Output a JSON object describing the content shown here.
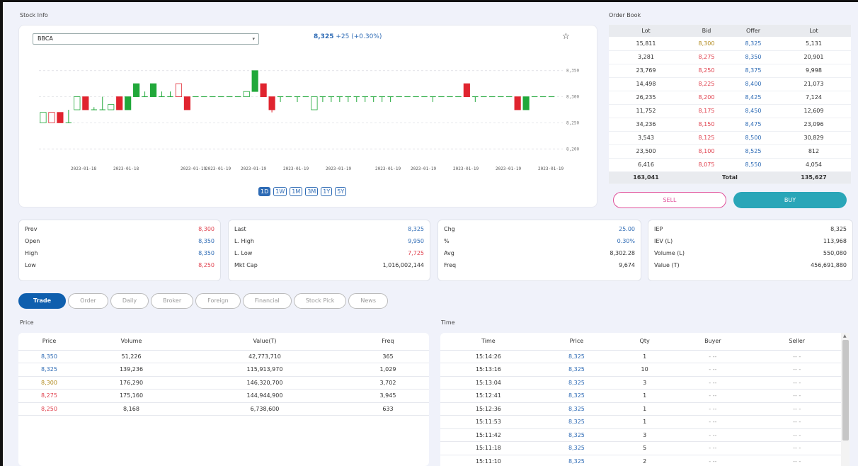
{
  "stock_info": {
    "section_title": "Stock Info",
    "symbol": "BBCA",
    "last": "8,325",
    "change": "+25 (+0.30%)",
    "y_ticks": [
      "8,350",
      "8,300",
      "8,250",
      "8,200"
    ],
    "x_ticks": [
      "2023-01-18",
      "2023-01-18",
      "2023-01-19",
      "2023-01-19",
      "2023-01-19",
      "2023-01-19",
      "2023-01-19",
      "2023-01-19",
      "2023-01-19",
      "2023-01-19",
      "2023-01-19",
      "2023-01-19"
    ],
    "ranges": [
      "1D",
      "1W",
      "1M",
      "3M",
      "1Y",
      "5Y"
    ],
    "active_range": "1D",
    "colors": {
      "up": "#21a83a",
      "down": "#e0242f",
      "flat": "#21a83a"
    }
  },
  "order_book": {
    "section_title": "Order Book",
    "headers": [
      "Lot",
      "Bid",
      "Offer",
      "Lot"
    ],
    "rows": [
      {
        "bid_lot": "15,811",
        "bid": "8,300",
        "bid_color": "olive",
        "offer": "8,325",
        "offer_lot": "5,131"
      },
      {
        "bid_lot": "3,281",
        "bid": "8,275",
        "bid_color": "red",
        "offer": "8,350",
        "offer_lot": "20,901"
      },
      {
        "bid_lot": "23,769",
        "bid": "8,250",
        "bid_color": "red",
        "offer": "8,375",
        "offer_lot": "9,998"
      },
      {
        "bid_lot": "14,498",
        "bid": "8,225",
        "bid_color": "red",
        "offer": "8,400",
        "offer_lot": "21,073"
      },
      {
        "bid_lot": "26,235",
        "bid": "8,200",
        "bid_color": "red",
        "offer": "8,425",
        "offer_lot": "7,124"
      },
      {
        "bid_lot": "11,752",
        "bid": "8,175",
        "bid_color": "red",
        "offer": "8,450",
        "offer_lot": "12,609"
      },
      {
        "bid_lot": "34,236",
        "bid": "8,150",
        "bid_color": "red",
        "offer": "8,475",
        "offer_lot": "23,096"
      },
      {
        "bid_lot": "3,543",
        "bid": "8,125",
        "bid_color": "red",
        "offer": "8,500",
        "offer_lot": "30,829"
      },
      {
        "bid_lot": "23,500",
        "bid": "8,100",
        "bid_color": "red",
        "offer": "8,525",
        "offer_lot": "812"
      },
      {
        "bid_lot": "6,416",
        "bid": "8,075",
        "bid_color": "red",
        "offer": "8,550",
        "offer_lot": "4,054"
      }
    ],
    "total_bid_lot": "163,041",
    "total_label": "Total",
    "total_offer_lot": "135,627",
    "sell_label": "SELL",
    "buy_label": "BUY"
  },
  "stats": [
    [
      {
        "k": "Prev",
        "v": "8,300",
        "c": "red"
      },
      {
        "k": "Open",
        "v": "8,350",
        "c": "blue"
      },
      {
        "k": "High",
        "v": "8,350",
        "c": "blue"
      },
      {
        "k": "Low",
        "v": "8,250",
        "c": "red"
      }
    ],
    [
      {
        "k": "Last",
        "v": "8,325",
        "c": "blue"
      },
      {
        "k": "L. High",
        "v": "9,950",
        "c": "blue"
      },
      {
        "k": "L. Low",
        "v": "7,725",
        "c": "red"
      },
      {
        "k": "Mkt Cap",
        "v": "1,016,002,144",
        "c": ""
      }
    ],
    [
      {
        "k": "Chg",
        "v": "25.00",
        "c": "blue"
      },
      {
        "k": "%",
        "v": "0.30%",
        "c": "blue"
      },
      {
        "k": "Avg",
        "v": "8,302.28",
        "c": ""
      },
      {
        "k": "Freq",
        "v": "9,674",
        "c": ""
      }
    ],
    [
      {
        "k": "IEP",
        "v": "8,325",
        "c": ""
      },
      {
        "k": "IEV (L)",
        "v": "113,968",
        "c": ""
      },
      {
        "k": "Volume (L)",
        "v": "550,080",
        "c": ""
      },
      {
        "k": "Value (T)",
        "v": "456,691,880",
        "c": ""
      }
    ]
  ],
  "tabs": [
    "Trade",
    "Order",
    "Daily",
    "Broker",
    "Foreign",
    "Financial",
    "Stock Pick",
    "News"
  ],
  "active_tab": "Trade",
  "price_table": {
    "section_title": "Price",
    "headers": [
      "Price",
      "Volume",
      "Value(T)",
      "Freq"
    ],
    "rows": [
      {
        "price": "8,350",
        "c": "blue",
        "volume": "51,226",
        "value": "42,773,710",
        "freq": "365"
      },
      {
        "price": "8,325",
        "c": "blue",
        "volume": "139,236",
        "value": "115,913,970",
        "freq": "1,029"
      },
      {
        "price": "8,300",
        "c": "olive",
        "volume": "176,290",
        "value": "146,320,700",
        "freq": "3,702"
      },
      {
        "price": "8,275",
        "c": "red",
        "volume": "175,160",
        "value": "144,944,900",
        "freq": "3,945"
      },
      {
        "price": "8,250",
        "c": "red",
        "volume": "8,168",
        "value": "6,738,600",
        "freq": "633"
      }
    ]
  },
  "time_table": {
    "section_title": "Time",
    "headers": [
      "Time",
      "Price",
      "Qty",
      "Buyer",
      "Seller"
    ],
    "rows": [
      {
        "time": "15:14:26",
        "price": "8,325",
        "qty": "1",
        "buyer": "- --",
        "seller": "-- -"
      },
      {
        "time": "15:13:16",
        "price": "8,325",
        "qty": "10",
        "buyer": "- --",
        "seller": "-- -"
      },
      {
        "time": "15:13:04",
        "price": "8,325",
        "qty": "3",
        "buyer": "- --",
        "seller": "-- -"
      },
      {
        "time": "15:12:41",
        "price": "8,325",
        "qty": "1",
        "buyer": "- --",
        "seller": "-- -"
      },
      {
        "time": "15:12:36",
        "price": "8,325",
        "qty": "1",
        "buyer": "- --",
        "seller": "-- -"
      },
      {
        "time": "15:11:53",
        "price": "8,325",
        "qty": "1",
        "buyer": "- --",
        "seller": "-- -"
      },
      {
        "time": "15:11:42",
        "price": "8,325",
        "qty": "3",
        "buyer": "- --",
        "seller": "-- -"
      },
      {
        "time": "15:11:18",
        "price": "8,325",
        "qty": "5",
        "buyer": "- --",
        "seller": "-- -"
      },
      {
        "time": "15:11:10",
        "price": "8,325",
        "qty": "2",
        "buyer": "- --",
        "seller": "-- -"
      }
    ]
  },
  "chart_data": {
    "type": "candlestick",
    "x": [
      "2023-01-18",
      "2023-01-18",
      "2023-01-19",
      "2023-01-19",
      "2023-01-19",
      "2023-01-19",
      "2023-01-19",
      "2023-01-19",
      "2023-01-19",
      "2023-01-19",
      "2023-01-19",
      "2023-01-19"
    ],
    "ylim": [
      8180,
      8370
    ],
    "y_ticks": [
      8350,
      8300,
      8250,
      8200
    ],
    "grid": true,
    "candles": [
      {
        "o": 8250,
        "c": 8270,
        "h": 8270,
        "l": 8250
      },
      {
        "o": 8270,
        "c": 8250,
        "h": 8270,
        "l": 8250
      },
      {
        "o": 8270,
        "c": 8250,
        "h": 8270,
        "l": 8250
      },
      {
        "o": 8250,
        "c": 8250,
        "h": 8275,
        "l": 8250
      },
      {
        "o": 8275,
        "c": 8300,
        "h": 8300,
        "l": 8275
      },
      {
        "o": 8300,
        "c": 8275,
        "h": 8300,
        "l": 8275
      },
      {
        "o": 8275,
        "c": 8275,
        "h": 8280,
        "l": 8275
      },
      {
        "o": 8275,
        "c": 8275,
        "h": 8300,
        "l": 8275
      },
      {
        "o": 8275,
        "c": 8285,
        "h": 8285,
        "l": 8275
      },
      {
        "o": 8300,
        "c": 8275,
        "h": 8300,
        "l": 8275
      },
      {
        "o": 8275,
        "c": 8300,
        "h": 8300,
        "l": 8275
      },
      {
        "o": 8300,
        "c": 8325,
        "h": 8325,
        "l": 8300
      },
      {
        "o": 8300,
        "c": 8300,
        "h": 8310,
        "l": 8300
      },
      {
        "o": 8300,
        "c": 8325,
        "h": 8325,
        "l": 8300
      },
      {
        "o": 8300,
        "c": 8300,
        "h": 8310,
        "l": 8300
      },
      {
        "o": 8300,
        "c": 8300,
        "h": 8310,
        "l": 8300
      },
      {
        "o": 8325,
        "c": 8300,
        "h": 8325,
        "l": 8300
      },
      {
        "o": 8300,
        "c": 8275,
        "h": 8300,
        "l": 8275
      },
      {
        "o": 8300,
        "c": 8300,
        "h": 8300,
        "l": 8300
      },
      {
        "o": 8300,
        "c": 8300,
        "h": 8300,
        "l": 8300
      },
      {
        "o": 8300,
        "c": 8300,
        "h": 8300,
        "l": 8300
      },
      {
        "o": 8300,
        "c": 8300,
        "h": 8300,
        "l": 8300
      },
      {
        "o": 8300,
        "c": 8300,
        "h": 8300,
        "l": 8300
      },
      {
        "o": 8300,
        "c": 8300,
        "h": 8300,
        "l": 8300
      },
      {
        "o": 8300,
        "c": 8310,
        "h": 8310,
        "l": 8300
      },
      {
        "o": 8310,
        "c": 8350,
        "h": 8350,
        "l": 8310
      },
      {
        "o": 8325,
        "c": 8300,
        "h": 8325,
        "l": 8300
      },
      {
        "o": 8300,
        "c": 8275,
        "h": 8300,
        "l": 8270
      },
      {
        "o": 8300,
        "c": 8300,
        "h": 8300,
        "l": 8290
      },
      {
        "o": 8300,
        "c": 8300,
        "h": 8300,
        "l": 8300
      },
      {
        "o": 8300,
        "c": 8300,
        "h": 8300,
        "l": 8290
      },
      {
        "o": 8300,
        "c": 8300,
        "h": 8300,
        "l": 8300
      },
      {
        "o": 8275,
        "c": 8300,
        "h": 8300,
        "l": 8275
      },
      {
        "o": 8300,
        "c": 8300,
        "h": 8300,
        "l": 8290
      },
      {
        "o": 8300,
        "c": 8300,
        "h": 8300,
        "l": 8290
      },
      {
        "o": 8300,
        "c": 8300,
        "h": 8300,
        "l": 8290
      },
      {
        "o": 8300,
        "c": 8300,
        "h": 8300,
        "l": 8290
      },
      {
        "o": 8300,
        "c": 8300,
        "h": 8300,
        "l": 8290
      },
      {
        "o": 8300,
        "c": 8300,
        "h": 8300,
        "l": 8290
      },
      {
        "o": 8300,
        "c": 8300,
        "h": 8300,
        "l": 8290
      },
      {
        "o": 8300,
        "c": 8300,
        "h": 8300,
        "l": 8290
      },
      {
        "o": 8300,
        "c": 8300,
        "h": 8300,
        "l": 8290
      },
      {
        "o": 8300,
        "c": 8300,
        "h": 8300,
        "l": 8300
      },
      {
        "o": 8300,
        "c": 8300,
        "h": 8300,
        "l": 8300
      },
      {
        "o": 8300,
        "c": 8300,
        "h": 8300,
        "l": 8300
      },
      {
        "o": 8300,
        "c": 8300,
        "h": 8300,
        "l": 8300
      },
      {
        "o": 8300,
        "c": 8300,
        "h": 8300,
        "l": 8290
      },
      {
        "o": 8300,
        "c": 8300,
        "h": 8300,
        "l": 8300
      },
      {
        "o": 8300,
        "c": 8300,
        "h": 8300,
        "l": 8300
      },
      {
        "o": 8300,
        "c": 8300,
        "h": 8300,
        "l": 8300
      },
      {
        "o": 8325,
        "c": 8300,
        "h": 8325,
        "l": 8300
      },
      {
        "o": 8300,
        "c": 8300,
        "h": 8300,
        "l": 8290
      },
      {
        "o": 8300,
        "c": 8300,
        "h": 8300,
        "l": 8300
      },
      {
        "o": 8300,
        "c": 8300,
        "h": 8300,
        "l": 8300
      },
      {
        "o": 8300,
        "c": 8300,
        "h": 8300,
        "l": 8300
      },
      {
        "o": 8300,
        "c": 8300,
        "h": 8300,
        "l": 8300
      },
      {
        "o": 8300,
        "c": 8275,
        "h": 8300,
        "l": 8275
      },
      {
        "o": 8275,
        "c": 8300,
        "h": 8300,
        "l": 8275
      },
      {
        "o": 8300,
        "c": 8300,
        "h": 8300,
        "l": 8300
      },
      {
        "o": 8300,
        "c": 8300,
        "h": 8300,
        "l": 8300
      },
      {
        "o": 8300,
        "c": 8300,
        "h": 8300,
        "l": 8300
      }
    ]
  }
}
